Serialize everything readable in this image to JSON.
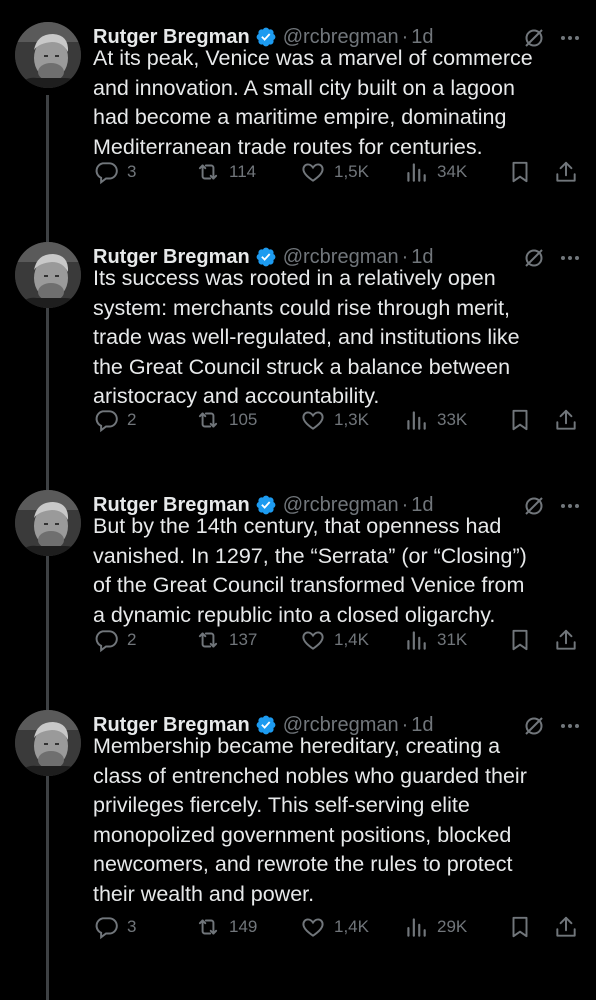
{
  "author": {
    "name": "Rutger Bregman",
    "handle": "@rcbregman",
    "separator": "·",
    "time": "1d"
  },
  "colors": {
    "background": "#000000",
    "text": "#e7e9ea",
    "muted": "#71767b",
    "verified": "#1d9bf0",
    "thread_line": "#3e4144"
  },
  "icons": [
    "verified-badge-icon",
    "grok-icon",
    "more-icon",
    "reply-icon",
    "retweet-icon",
    "like-icon",
    "views-icon",
    "bookmark-icon",
    "share-icon"
  ],
  "tweets": [
    {
      "text": "At its peak, Venice was a marvel of commerce\nand innovation. A small city built on a lagoon\nhad become a maritime empire, dominating\nMediterranean trade routes for centuries.",
      "replies": "3",
      "retweets": "114",
      "likes": "1,5K",
      "views": "34K"
    },
    {
      "text": "Its success was rooted in a relatively open\nsystem: merchants could rise through merit,\ntrade was well-regulated, and institutions like\nthe Great Council struck a balance between\naristocracy and accountability.",
      "replies": "2",
      "retweets": "105",
      "likes": "1,3K",
      "views": "33K"
    },
    {
      "text": "But by the 14th century, that openness had\nvanished. In 1297, the “Serrata” (or “Closing”)\nof the Great Council transformed Venice from\na dynamic republic into a closed oligarchy.",
      "replies": "2",
      "retweets": "137",
      "likes": "1,4K",
      "views": "31K"
    },
    {
      "text": "Membership became hereditary, creating a\nclass of entrenched nobles who guarded their\nprivileges fiercely. This self-serving elite\nmonopolized government positions, blocked\nnewcomers, and rewrote the rules to protect\ntheir wealth and power.",
      "replies": "3",
      "retweets": "149",
      "likes": "1,4K",
      "views": "29K"
    }
  ]
}
